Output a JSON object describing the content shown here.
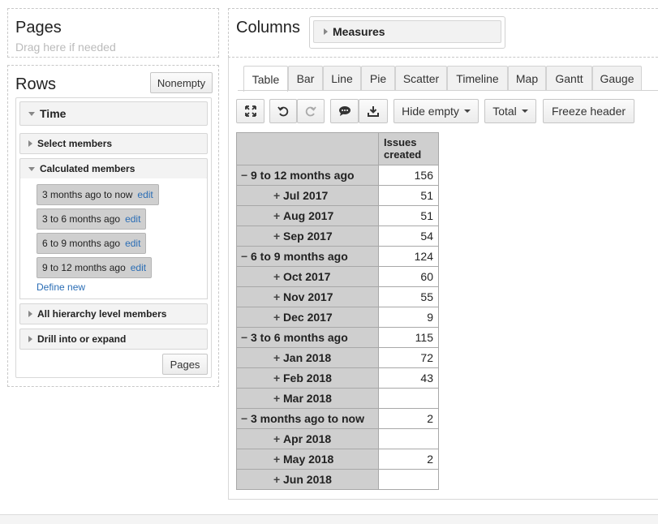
{
  "pages": {
    "title": "Pages",
    "hint": "Drag here if needed"
  },
  "columns": {
    "title": "Columns",
    "measure": "Measures"
  },
  "rows": {
    "title": "Rows",
    "nonempty_label": "Nonempty",
    "dimension": "Time",
    "select_members": "Select members",
    "calculated_members": "Calculated members",
    "members": [
      {
        "name": "3 months ago to now",
        "edit": "edit"
      },
      {
        "name": "3 to 6 months ago",
        "edit": "edit"
      },
      {
        "name": "6 to 9 months ago",
        "edit": "edit"
      },
      {
        "name": "9 to 12 months ago",
        "edit": "edit"
      }
    ],
    "define_new": "Define new",
    "all_hierarchy": "All hierarchy level members",
    "drill": "Drill into or expand",
    "pages_button": "Pages"
  },
  "tabs": [
    "Table",
    "Bar",
    "Line",
    "Pie",
    "Scatter",
    "Timeline",
    "Map",
    "Gantt",
    "Gauge"
  ],
  "toolbar": {
    "hide_empty": "Hide empty",
    "total": "Total",
    "freeze_header": "Freeze header"
  },
  "table": {
    "measure_header_line1": "Issues",
    "measure_header_line2": "created",
    "rows": [
      {
        "sign": "−",
        "level": 0,
        "label": "9 to 12 months ago",
        "value": "156"
      },
      {
        "sign": "+",
        "level": 1,
        "label": "Jul 2017",
        "value": "51"
      },
      {
        "sign": "+",
        "level": 1,
        "label": "Aug 2017",
        "value": "51"
      },
      {
        "sign": "+",
        "level": 1,
        "label": "Sep 2017",
        "value": "54"
      },
      {
        "sign": "−",
        "level": 0,
        "label": "6 to 9 months ago",
        "value": "124"
      },
      {
        "sign": "+",
        "level": 1,
        "label": "Oct 2017",
        "value": "60"
      },
      {
        "sign": "+",
        "level": 1,
        "label": "Nov 2017",
        "value": "55"
      },
      {
        "sign": "+",
        "level": 1,
        "label": "Dec 2017",
        "value": "9"
      },
      {
        "sign": "−",
        "level": 0,
        "label": "3 to 6 months ago",
        "value": "115"
      },
      {
        "sign": "+",
        "level": 1,
        "label": "Jan 2018",
        "value": "72"
      },
      {
        "sign": "+",
        "level": 1,
        "label": "Feb 2018",
        "value": "43"
      },
      {
        "sign": "+",
        "level": 1,
        "label": "Mar 2018",
        "value": ""
      },
      {
        "sign": "−",
        "level": 0,
        "label": "3 months ago to now",
        "value": "2"
      },
      {
        "sign": "+",
        "level": 1,
        "label": "Apr 2018",
        "value": ""
      },
      {
        "sign": "+",
        "level": 1,
        "label": "May 2018",
        "value": "2"
      },
      {
        "sign": "+",
        "level": 1,
        "label": "Jun 2018",
        "value": ""
      }
    ]
  },
  "colors": {
    "link": "#2a6db5",
    "header_gray": "#cfcfcf",
    "border": "#a8a8a8"
  }
}
